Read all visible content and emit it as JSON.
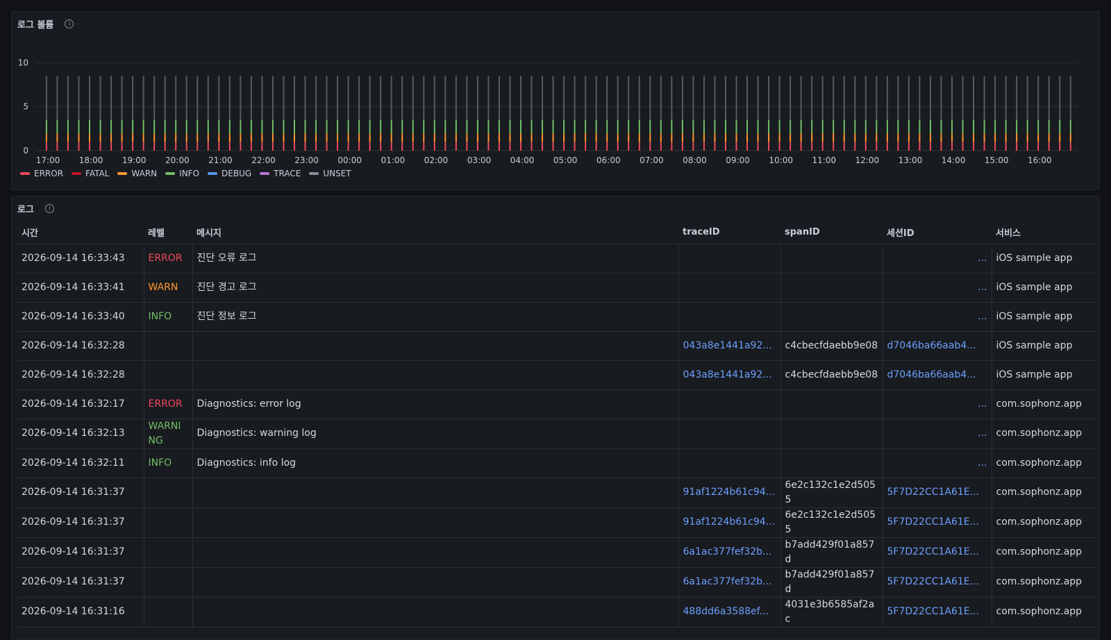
{
  "volume_panel": {
    "title": "로그 볼륨",
    "info_icon": "info-icon"
  },
  "chart_data": {
    "type": "bar",
    "stacked": true,
    "ylim": [
      0,
      12
    ],
    "y_ticks": [
      0,
      5,
      10
    ],
    "x_ticks": [
      "17:00",
      "18:00",
      "19:00",
      "20:00",
      "21:00",
      "22:00",
      "23:00",
      "00:00",
      "01:00",
      "02:00",
      "03:00",
      "04:00",
      "05:00",
      "06:00",
      "07:00",
      "08:00",
      "09:00",
      "10:00",
      "11:00",
      "12:00",
      "13:00",
      "14:00",
      "15:00",
      "16:00"
    ],
    "legend": [
      {
        "name": "ERROR",
        "color": "#f2495c"
      },
      {
        "name": "FATAL",
        "color": "#c4162a"
      },
      {
        "name": "WARN",
        "color": "#ff9830"
      },
      {
        "name": "INFO",
        "color": "#73bf69"
      },
      {
        "name": "DEBUG",
        "color": "#5794f2"
      },
      {
        "name": "TRACE",
        "color": "#b877d9"
      },
      {
        "name": "UNSET",
        "color": "#8e8e9a"
      }
    ],
    "bars_per_hour": 4,
    "bar_stack_values": {
      "ERROR": 1,
      "WARN": 1,
      "INFO": 1.5,
      "UNSET": 5
    }
  },
  "logs_panel": {
    "title": "로그",
    "columns": [
      "시간",
      "레벨",
      "메시지",
      "traceID",
      "spanID",
      "세션ID",
      "서비스"
    ],
    "rows": [
      {
        "time": "2026-09-14 16:33:43",
        "level": "ERROR",
        "message": "진단 오류 로그",
        "trace": "",
        "span": "",
        "session": "...",
        "service": "iOS sample app"
      },
      {
        "time": "2026-09-14 16:33:41",
        "level": "WARN",
        "message": "진단 경고 로그",
        "trace": "",
        "span": "",
        "session": "...",
        "service": "iOS sample app"
      },
      {
        "time": "2026-09-14 16:33:40",
        "level": "INFO",
        "message": "진단 정보 로그",
        "trace": "",
        "span": "",
        "session": "...",
        "service": "iOS sample app"
      },
      {
        "time": "2026-09-14 16:32:28",
        "level": "",
        "message": "",
        "trace": "043a8e1441a92...",
        "span": "c4cbecfdaebb9e08",
        "session": "d7046ba66aab4...",
        "service": "iOS sample app"
      },
      {
        "time": "2026-09-14 16:32:28",
        "level": "",
        "message": "",
        "trace": "043a8e1441a92...",
        "span": "c4cbecfdaebb9e08",
        "session": "d7046ba66aab4...",
        "service": "iOS sample app"
      },
      {
        "time": "2026-09-14 16:32:17",
        "level": "ERROR",
        "message": "Diagnostics: error log",
        "trace": "",
        "span": "",
        "session": "...",
        "service": "com.sophonz.app"
      },
      {
        "time": "2026-09-14 16:32:13",
        "level": "WARNING",
        "message": "Diagnostics: warning log",
        "trace": "",
        "span": "",
        "session": "...",
        "service": "com.sophonz.app"
      },
      {
        "time": "2026-09-14 16:32:11",
        "level": "INFO",
        "message": "Diagnostics: info log",
        "trace": "",
        "span": "",
        "session": "...",
        "service": "com.sophonz.app"
      },
      {
        "time": "2026-09-14 16:31:37",
        "level": "",
        "message": "",
        "trace": "91af1224b61c94...",
        "span": "6e2c132c1e2d5055",
        "session": "5F7D22CC1A61E...",
        "service": "com.sophonz.app"
      },
      {
        "time": "2026-09-14 16:31:37",
        "level": "",
        "message": "",
        "trace": "91af1224b61c94...",
        "span": "6e2c132c1e2d5055",
        "session": "5F7D22CC1A61E...",
        "service": "com.sophonz.app"
      },
      {
        "time": "2026-09-14 16:31:37",
        "level": "",
        "message": "",
        "trace": "6a1ac377fef32b...",
        "span": "b7add429f01a857d",
        "session": "5F7D22CC1A61E...",
        "service": "com.sophonz.app"
      },
      {
        "time": "2026-09-14 16:31:37",
        "level": "",
        "message": "",
        "trace": "6a1ac377fef32b...",
        "span": "b7add429f01a857d",
        "session": "5F7D22CC1A61E...",
        "service": "com.sophonz.app"
      },
      {
        "time": "2026-09-14 16:31:16",
        "level": "",
        "message": "",
        "trace": "488dd6a3588ef...",
        "span": "4031e3b6585af2ac",
        "session": "5F7D22CC1A61E...",
        "service": "com.sophonz.app"
      }
    ]
  }
}
